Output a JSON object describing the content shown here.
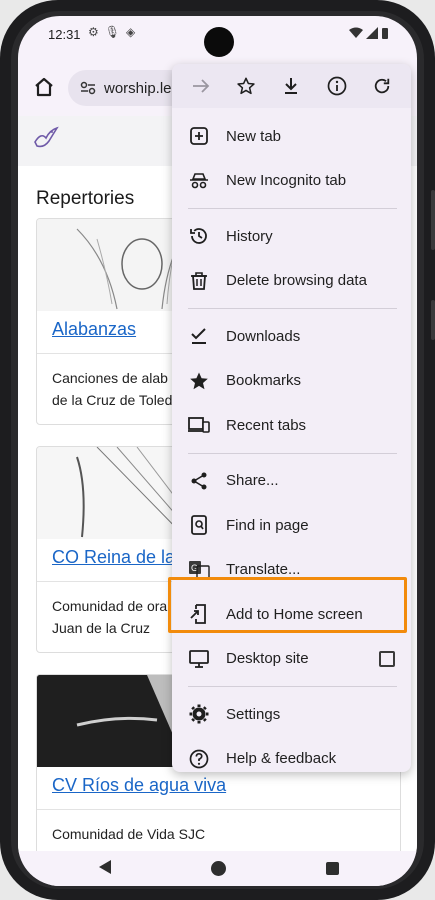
{
  "status_bar": {
    "time": "12:31"
  },
  "toolbar": {
    "url": "worship.leb"
  },
  "page": {
    "section_title": "Repertories",
    "cards": [
      {
        "title": "Alabanzas",
        "desc_line1": "Canciones de alab",
        "desc_line2": "de la Cruz de Toled"
      },
      {
        "title": "CO Reina de la",
        "desc_line1": "Comunidad de ora",
        "desc_line2": "Juan de la Cruz"
      },
      {
        "title": "CV Ríos de agua viva",
        "desc_line1": "Comunidad de Vida SJC",
        "desc_line2": ""
      }
    ]
  },
  "menu": {
    "items": {
      "new_tab": "New tab",
      "incognito": "New Incognito tab",
      "history": "History",
      "delete": "Delete browsing data",
      "downloads": "Downloads",
      "bookmarks": "Bookmarks",
      "recent_tabs": "Recent tabs",
      "share": "Share...",
      "find": "Find in page",
      "translate": "Translate...",
      "add_home": "Add to Home screen",
      "desktop": "Desktop site",
      "settings": "Settings",
      "help": "Help & feedback"
    }
  },
  "colors": {
    "highlight": "#f28b0c",
    "link": "#1a66c7",
    "menu_bg": "#f3eef7"
  }
}
